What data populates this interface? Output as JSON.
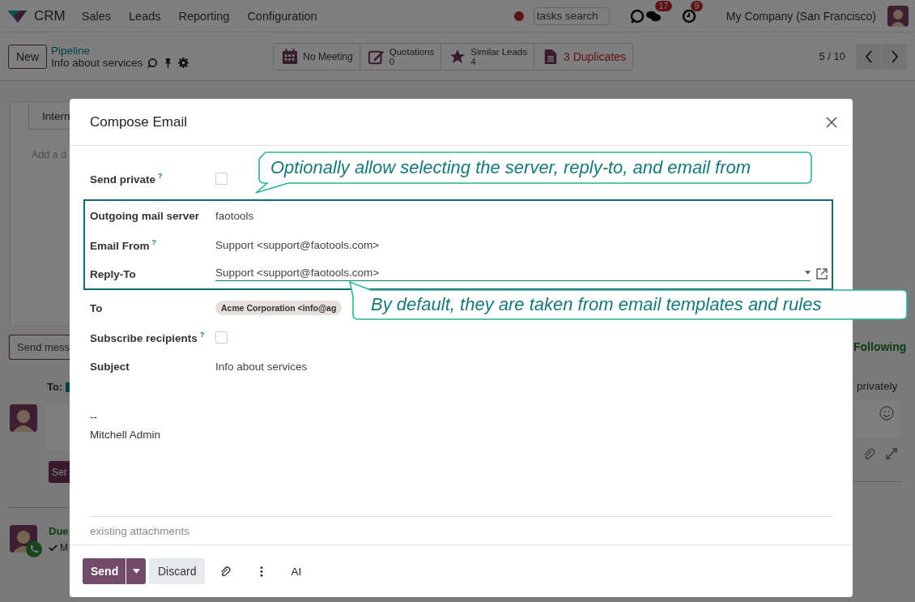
{
  "navbar": {
    "app": "CRM",
    "menus": [
      "Sales",
      "Leads",
      "Reporting",
      "Configuration"
    ],
    "search": {
      "placeholder": "tasks search"
    },
    "messages_badge": "17",
    "activities_badge": "9",
    "company": "My Company (San Francisco)"
  },
  "control_panel": {
    "new_button": "New",
    "breadcrumb": "Pipeline",
    "record_title": "Info about services",
    "smart_buttons": [
      {
        "kind": "calendar",
        "label": "No Meeting",
        "alert": false
      },
      {
        "kind": "quotation",
        "label": "Quotations",
        "count": "0",
        "alert": false
      },
      {
        "kind": "star",
        "label": "Similar Leads",
        "count": "4",
        "alert": false
      },
      {
        "kind": "document",
        "label": "3 Duplicates",
        "alert": true
      }
    ],
    "pager": "5 / 10"
  },
  "background": {
    "tab": "Intern",
    "note_placeholder": "Add a d",
    "send_message_button": "Send mess",
    "following": "Following",
    "to_label": "To:",
    "to_checked": true,
    "privately": "privately",
    "send_button": "Ser",
    "activity_title": "Due",
    "activity_line": "M"
  },
  "dialog": {
    "title": "Compose Email",
    "sections": [
      {
        "kind": "plain",
        "fields": [
          {
            "kind": "checkbox",
            "label": "Send private",
            "help": "?",
            "checked": false
          }
        ]
      },
      {
        "kind": "highlighted",
        "fields": [
          {
            "kind": "text",
            "label": "Outgoing mail server",
            "value": "faotools"
          },
          {
            "kind": "text",
            "label": "Email From",
            "help": "?",
            "value": "Support <support@faotools.com>"
          },
          {
            "kind": "select",
            "label": "Reply-To",
            "value": "Support <support@faotools.com>"
          }
        ]
      },
      {
        "kind": "plain",
        "fields": [
          {
            "kind": "tags",
            "label": "To",
            "tags": [
              "Acme Corporation <info@ag"
            ]
          },
          {
            "kind": "checkbox",
            "label": "Subscribe recipients",
            "help": "?",
            "checked": false
          },
          {
            "kind": "text",
            "label": "Subject",
            "value": "Info about services"
          }
        ]
      }
    ],
    "body_lines": [
      "--",
      "Mitchell Admin"
    ],
    "attachments_label": "existing attachments",
    "buttons": {
      "send": "Send",
      "discard": "Discard",
      "ai": "AI"
    }
  },
  "callouts": [
    {
      "text": "Optionally allow selecting the server, reply-to, and email from"
    },
    {
      "text": "By default, they are taken from email templates and rules"
    }
  ]
}
